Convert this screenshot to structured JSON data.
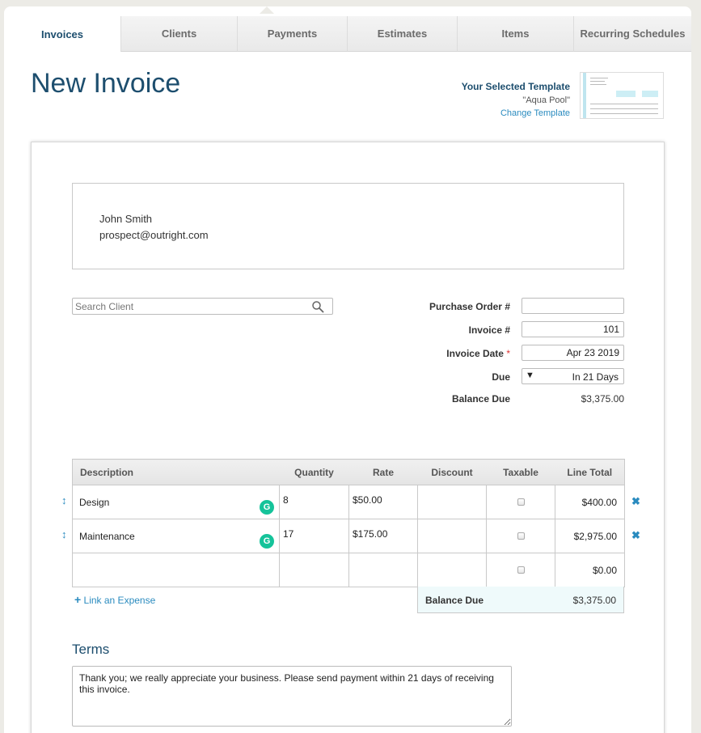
{
  "tabs": [
    {
      "label": "Invoices",
      "active": true
    },
    {
      "label": "Clients"
    },
    {
      "label": "Payments"
    },
    {
      "label": "Estimates"
    },
    {
      "label": "Items"
    },
    {
      "label": "Recurring Schedules"
    }
  ],
  "page_title": "New Invoice",
  "template": {
    "label": "Your Selected Template",
    "name": "\"Aqua Pool\"",
    "change_link": "Change Template"
  },
  "client": {
    "name": "John Smith",
    "email": "prospect@outright.com"
  },
  "search": {
    "placeholder": "Search Client",
    "value": ""
  },
  "fields": {
    "po_label": "Purchase Order #",
    "po_value": "",
    "invoice_no_label": "Invoice #",
    "invoice_no_value": "101",
    "invoice_date_label": "Invoice Date",
    "required_marker": "*",
    "invoice_date_value": "Apr 23 2019",
    "due_label": "Due",
    "due_value": "In 21 Days",
    "due_arrow": "▼",
    "balance_due_label": "Balance Due",
    "balance_due_value": "$3,375.00"
  },
  "table": {
    "headers": {
      "description": "Description",
      "quantity": "Quantity",
      "rate": "Rate",
      "discount": "Discount",
      "taxable": "Taxable",
      "line_total": "Line Total"
    },
    "rows": [
      {
        "description": "Design",
        "quantity": "8",
        "rate": "$50.00",
        "discount": "",
        "line_total": "$400.00"
      },
      {
        "description": "Maintenance",
        "quantity": "17",
        "rate": "$175.00",
        "discount": "",
        "line_total": "$2,975.00"
      },
      {
        "description": "",
        "quantity": "",
        "rate": "",
        "discount": "",
        "line_total": "$0.00"
      }
    ],
    "grammarly_glyph": "G",
    "drag_glyph": "↕",
    "remove_glyph": "✖"
  },
  "link_expense": {
    "plus": "+",
    "label": "Link an Expense"
  },
  "summary": {
    "balance_due_label": "Balance Due",
    "balance_due_value": "$3,375.00"
  },
  "terms": {
    "heading": "Terms",
    "text": "Thank you; we really appreciate your business. Please send payment within 21 days of receiving this invoice."
  },
  "icons": {
    "search": "search-icon",
    "drag": "drag-handle-icon",
    "remove": "remove-row-icon",
    "grammarly": "grammarly-icon",
    "plus": "plus-icon"
  },
  "colors": {
    "title": "#1d4e6e",
    "link": "#2a8bbf",
    "grammarly": "#15c39a",
    "balance_bg": "#effafb"
  }
}
